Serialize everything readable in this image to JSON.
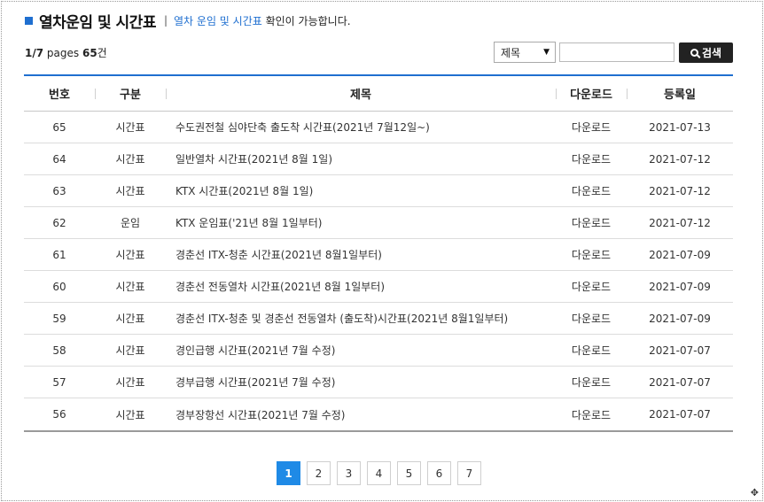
{
  "header": {
    "title": "열차운임 및 시간표",
    "separator": "|",
    "desc_highlight": "열차 운임 및 시간표",
    "desc_rest": " 확인이 가능합니다."
  },
  "pager_info": {
    "current": "1",
    "slash": "/",
    "total": "7",
    "pages_word": " pages ",
    "count": "65",
    "count_unit": "건"
  },
  "search": {
    "field_selected": "제목",
    "field_options": [
      "제목"
    ],
    "query_value": "",
    "button_label": "검색"
  },
  "table": {
    "columns": [
      "번호",
      "구분",
      "제목",
      "다운로드",
      "등록일"
    ],
    "rows": [
      {
        "no": "65",
        "category": "시간표",
        "title": "수도권전철 심야단축 출도착 시간표(2021년 7월12일~)",
        "download": "다운로드",
        "date": "2021-07-13"
      },
      {
        "no": "64",
        "category": "시간표",
        "title": "일반열차 시간표(2021년 8월 1일)",
        "download": "다운로드",
        "date": "2021-07-12"
      },
      {
        "no": "63",
        "category": "시간표",
        "title": "KTX 시간표(2021년 8월 1일)",
        "download": "다운로드",
        "date": "2021-07-12"
      },
      {
        "no": "62",
        "category": "운임",
        "title": "KTX 운임표('21년 8월 1일부터)",
        "download": "다운로드",
        "date": "2021-07-12"
      },
      {
        "no": "61",
        "category": "시간표",
        "title": "경춘선 ITX-청춘 시간표(2021년 8월1일부터)",
        "download": "다운로드",
        "date": "2021-07-09"
      },
      {
        "no": "60",
        "category": "시간표",
        "title": "경춘선 전동열차 시간표(2021년 8월 1일부터)",
        "download": "다운로드",
        "date": "2021-07-09"
      },
      {
        "no": "59",
        "category": "시간표",
        "title": "경춘선 ITX-청춘 및 경춘선 전동열차 (출도착)시간표(2021년 8월1일부터)",
        "download": "다운로드",
        "date": "2021-07-09"
      },
      {
        "no": "58",
        "category": "시간표",
        "title": "경인급행 시간표(2021년 7월 수정)",
        "download": "다운로드",
        "date": "2021-07-07"
      },
      {
        "no": "57",
        "category": "시간표",
        "title": "경부급행 시간표(2021년 7월 수정)",
        "download": "다운로드",
        "date": "2021-07-07"
      },
      {
        "no": "56",
        "category": "시간표",
        "title": "경부장항선 시간표(2021년 7월 수정)",
        "download": "다운로드",
        "date": "2021-07-07"
      }
    ]
  },
  "pagination": {
    "pages": [
      "1",
      "2",
      "3",
      "4",
      "5",
      "6",
      "7"
    ],
    "active": "1"
  },
  "icons": {
    "title_marker": "square-bullet-icon",
    "search": "search-icon",
    "select_arrow": "chevron-down-icon",
    "resize": "resize-grip-icon"
  },
  "colors": {
    "accent": "#1f6fd0",
    "active_page": "#1f8ae6",
    "search_button": "#222222"
  }
}
